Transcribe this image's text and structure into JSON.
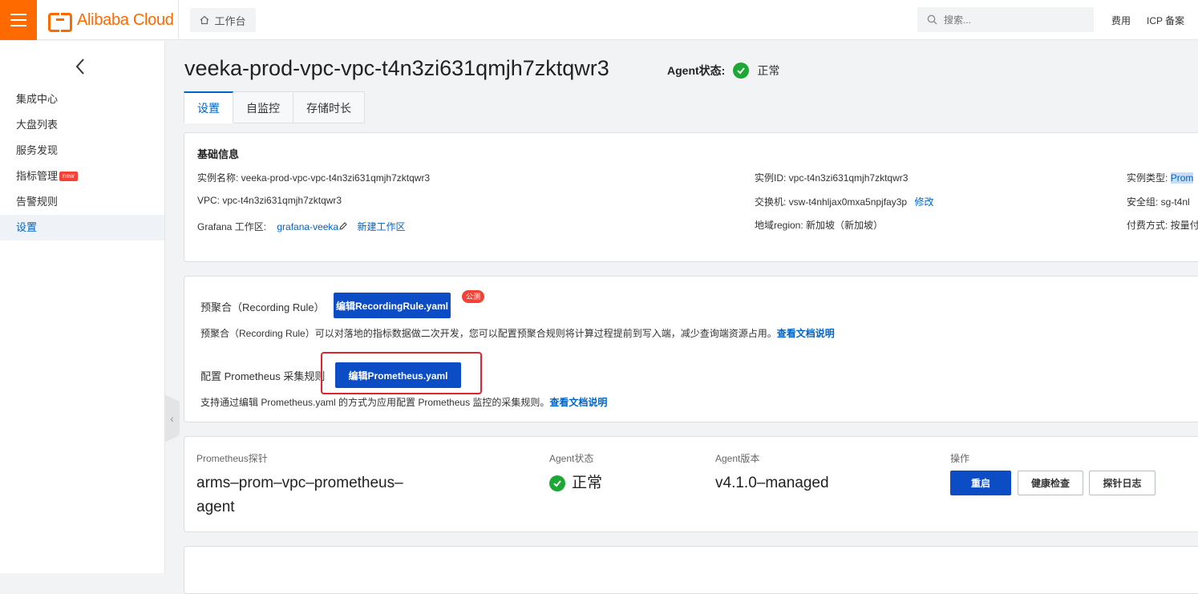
{
  "topbar": {
    "brand": "Alibaba Cloud",
    "workbench": "工作台",
    "search_placeholder": "搜索...",
    "links": [
      "费用",
      "ICP 备案"
    ]
  },
  "sidebar": {
    "items": [
      {
        "label": "集成中心"
      },
      {
        "label": "大盘列表"
      },
      {
        "label": "服务发现"
      },
      {
        "label": "指标管理",
        "badge": "new"
      },
      {
        "label": "告警规则"
      },
      {
        "label": "设置",
        "active": true
      }
    ]
  },
  "page": {
    "title": "veeka-prod-vpc-vpc-t4n3zi631qmjh7zktqwr3",
    "agent_status_label": "Agent状态:",
    "agent_status_value": "正常"
  },
  "tabs": [
    {
      "label": "设置",
      "active": true
    },
    {
      "label": "自监控"
    },
    {
      "label": "存储时长"
    }
  ],
  "basic_info": {
    "title": "基础信息",
    "instance_name": "实例名称:  veeka-prod-vpc-vpc-t4n3zi631qmjh7zktqwr3",
    "vpc": "VPC:  vpc-t4n3zi631qmjh7zktqwr3",
    "grafana_label": "Grafana 工作区:",
    "grafana_value": "grafana-veeka",
    "new_workspace": "新建工作区",
    "instance_id": "实例ID:  vpc-t4n3zi631qmjh7zktqwr3",
    "vswitch": "交换机:  vsw-t4nhljax0mxa5npjfay3p",
    "modify": "修改",
    "region": "地域region:  新加坡（新加坡）",
    "instance_type_label": "实例类型:",
    "instance_type_value": "Prom",
    "security_group": "安全组:  sg-t4nl",
    "billing": "付费方式:  按量付"
  },
  "rules": {
    "recording_label": "预聚合（Recording Rule）",
    "recording_button": "编辑RecordingRule.yaml",
    "beta_badge": "公测",
    "recording_desc": "预聚合（Recording Rule）可以对落地的指标数据做二次开发，您可以配置预聚合规则将计算过程提前到写入端，减少查询端资源占用。",
    "doc_link": "查看文档说明",
    "prometheus_label": "配置 Prometheus 采集规则",
    "prometheus_button": "编辑Prometheus.yaml",
    "prometheus_desc": "支持通过编辑 Prometheus.yaml 的方式为应用配置 Prometheus 监控的采集规则。",
    "doc_link2": "查看文档说明"
  },
  "probe": {
    "col_probe": "Prometheus探针",
    "col_status": "Agent状态",
    "col_version": "Agent版本",
    "col_ops": "操作",
    "probe_name_line1": "arms–prom–vpc–prometheus–",
    "probe_name_line2": "agent",
    "status": "正常",
    "version": "v4.1.0–managed",
    "btn_restart": "重启",
    "btn_health": "健康检查",
    "btn_log": "探针日志"
  },
  "colors": {
    "brand_orange": "#ff6a00",
    "primary_blue": "#0c4cc4",
    "link_blue": "#0064c8",
    "success_green": "#1da835",
    "highlight_red": "#e0242e"
  }
}
